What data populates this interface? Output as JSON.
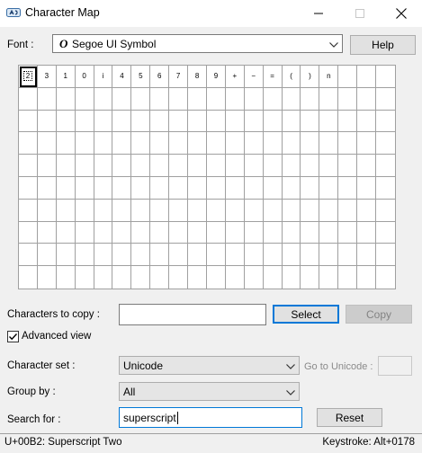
{
  "window": {
    "title": "Character Map",
    "minimize_icon": "minimize-icon",
    "maximize_icon": "maximize-icon",
    "close_icon": "close-icon"
  },
  "font": {
    "label": "Font :",
    "value": "Segoe UI Symbol",
    "help_label": "Help"
  },
  "grid": {
    "columns": 20,
    "rows": 10,
    "characters": [
      "2",
      "3",
      "1",
      "0",
      "i",
      "4",
      "5",
      "6",
      "7",
      "8",
      "9",
      "+",
      "−",
      "=",
      "(",
      ")",
      "n"
    ],
    "selected_index": 0
  },
  "copy": {
    "label": "Characters to copy :",
    "value": "",
    "select_label": "Select",
    "copy_label": "Copy"
  },
  "advanced": {
    "label": "Advanced view",
    "checked": true
  },
  "charset": {
    "label": "Character set :",
    "value": "Unicode",
    "goto_label": "Go to Unicode :",
    "goto_value": ""
  },
  "groupby": {
    "label": "Group by :",
    "value": "All"
  },
  "search": {
    "label": "Search for :",
    "value": "superscript",
    "button_label": "Reset"
  },
  "status": {
    "left": "U+00B2: Superscript Two",
    "right": "Keystroke: Alt+0178"
  },
  "colors": {
    "accent": "#0078d7",
    "window_bg": "#f0f0f0"
  }
}
